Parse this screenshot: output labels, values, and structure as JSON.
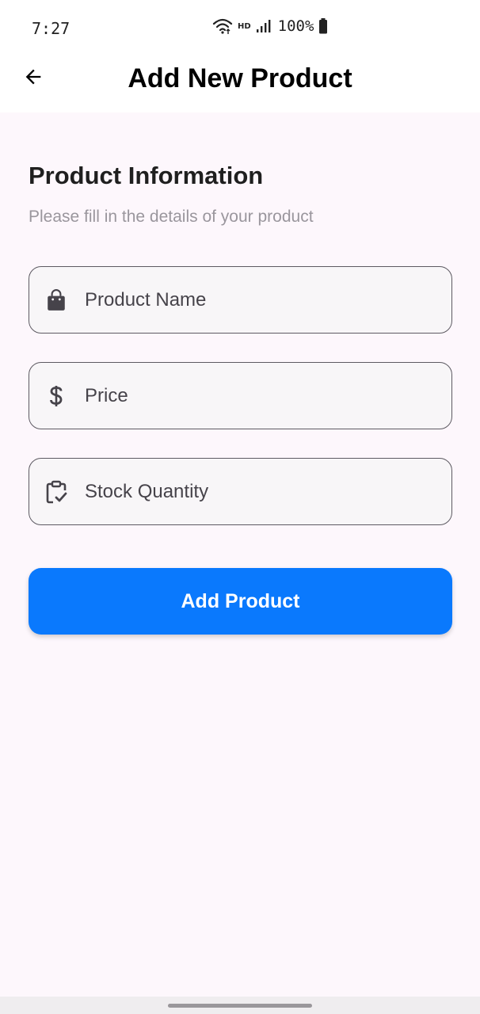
{
  "status_bar": {
    "time": "7:27",
    "network_badge": "HD",
    "battery": "100%",
    "icons": [
      "wifi-icon",
      "signal-icon",
      "battery-icon"
    ]
  },
  "app_bar": {
    "title": "Add New Product",
    "back_icon": "arrow-back-icon"
  },
  "form": {
    "section_title": "Product Information",
    "section_subtitle": "Please fill in the details of your product",
    "fields": [
      {
        "icon": "shopping-bag-icon",
        "placeholder": "Product Name",
        "value": ""
      },
      {
        "icon": "dollar-icon",
        "placeholder": "Price",
        "value": ""
      },
      {
        "icon": "clipboard-check-icon",
        "placeholder": "Stock Quantity",
        "value": ""
      }
    ],
    "submit_label": "Add Product"
  },
  "colors": {
    "background": "#fdf7fc",
    "primary": "#0a79fd",
    "field_border": "#5d5a62",
    "subtitle": "#9a969d"
  }
}
